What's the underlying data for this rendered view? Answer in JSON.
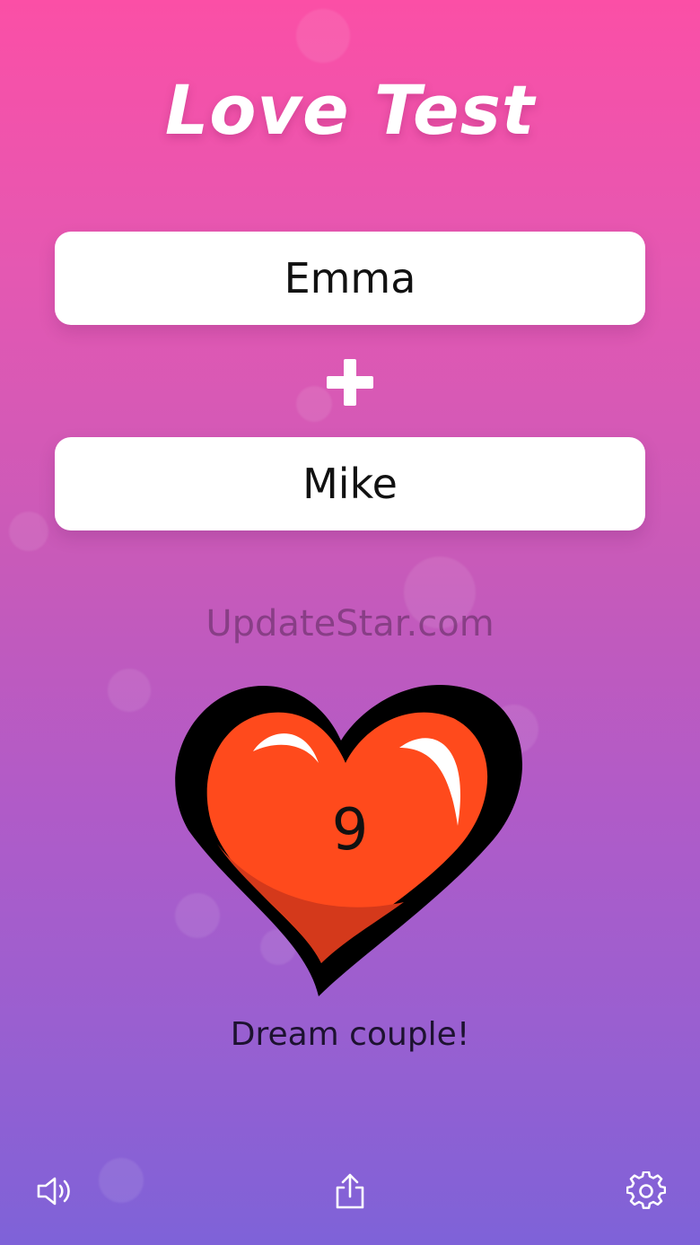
{
  "app": {
    "title": "Love Test"
  },
  "names": {
    "first": "Emma",
    "second": "Mike"
  },
  "watermark": "UpdateStar.com",
  "result": {
    "score": "9",
    "message": "Dream couple!"
  },
  "toolbar": {
    "sound_icon": "speaker-icon",
    "share_icon": "share-icon",
    "settings_icon": "gear-icon"
  },
  "colors": {
    "gradient_top": "#fb4fa6",
    "gradient_bottom": "#7e62d8",
    "heart_fill": "#ff4a1c",
    "heart_outline": "#000000"
  }
}
